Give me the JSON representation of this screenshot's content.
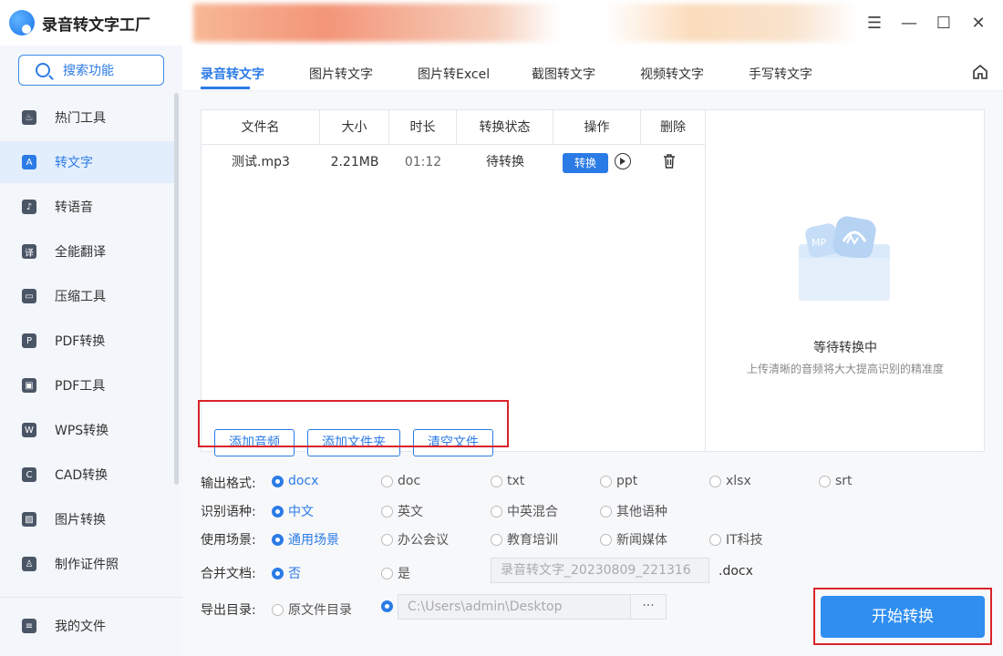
{
  "app": {
    "title": "录音转文字工厂"
  },
  "window": {
    "menu": "☰",
    "minimize": "—",
    "maximize": "☐",
    "close": "✕"
  },
  "sidebar": {
    "search_label": "搜索功能",
    "items": [
      {
        "label": "热门工具",
        "icon": "flame-icon",
        "glyph": "♨"
      },
      {
        "label": "转文字",
        "icon": "text-convert-icon",
        "glyph": "A"
      },
      {
        "label": "转语音",
        "icon": "voice-icon",
        "glyph": "♪"
      },
      {
        "label": "全能翻译",
        "icon": "translate-icon",
        "glyph": "译"
      },
      {
        "label": "压缩工具",
        "icon": "compress-icon",
        "glyph": "▭"
      },
      {
        "label": "PDF转换",
        "icon": "pdf-convert-icon",
        "glyph": "P"
      },
      {
        "label": "PDF工具",
        "icon": "toolbox-icon",
        "glyph": "▣"
      },
      {
        "label": "WPS转换",
        "icon": "wps-icon",
        "glyph": "W"
      },
      {
        "label": "CAD转换",
        "icon": "cad-icon",
        "glyph": "C"
      },
      {
        "label": "图片转换",
        "icon": "image-icon",
        "glyph": "▨"
      },
      {
        "label": "制作证件照",
        "icon": "id-photo-icon",
        "glyph": "♙"
      }
    ],
    "my_files": "我的文件"
  },
  "tabs": [
    "录音转文字",
    "图片转文字",
    "图片转Excel",
    "截图转文字",
    "视频转文字",
    "手写转文字"
  ],
  "table": {
    "headers": [
      "文件名",
      "大小",
      "时长",
      "转换状态",
      "操作",
      "删除"
    ],
    "rows": [
      {
        "name": "测试.mp3",
        "size": "2.21MB",
        "duration": "01:12",
        "status": "待转换",
        "action": "转换"
      }
    ]
  },
  "preview": {
    "title": "等待转换中",
    "subtitle": "上传清晰的音频将大大提高识别的精准度",
    "art_label": "MP"
  },
  "file_buttons": {
    "add_audio": "添加音频",
    "add_folder": "添加文件夹",
    "clear": "清空文件"
  },
  "options": {
    "format_label": "输出格式:",
    "formats": [
      "docx",
      "doc",
      "txt",
      "ppt",
      "xlsx",
      "srt"
    ],
    "language_label": "识别语种:",
    "languages": [
      "中文",
      "英文",
      "中英混合",
      "其他语种"
    ],
    "scene_label": "使用场景:",
    "scenes": [
      "通用场景",
      "办公会议",
      "教育培训",
      "新闻媒体",
      "IT科技"
    ],
    "merge_label": "合并文档:",
    "merge_options": [
      "否",
      "是"
    ],
    "merge_filename": "录音转文字_20230809_221316",
    "merge_suffix": ".docx",
    "export_label": "导出目录:",
    "export_options": [
      "原文件目录"
    ],
    "export_path": "C:\\Users\\admin\\Desktop",
    "browse": "···"
  },
  "start_button": "开始转换",
  "colors": {
    "accent": "#2b7be6",
    "highlight": "#d9232a"
  }
}
